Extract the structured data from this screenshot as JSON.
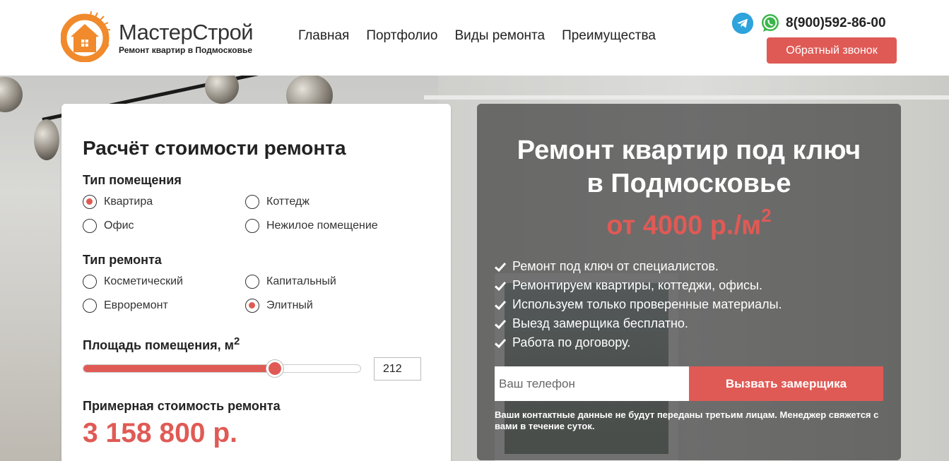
{
  "header": {
    "brand_name": "МастерСтрой",
    "brand_tagline": "Ремонт квартир в Подмосковье",
    "nav": [
      "Главная",
      "Портфолио",
      "Виды ремонта",
      "Преимущества"
    ],
    "phone": "8(900)592-86-00",
    "callback_label": "Обратный звонок",
    "icons": [
      "telegram-icon",
      "whatsapp-icon"
    ]
  },
  "calculator": {
    "title": "Расчёт стоимости ремонта",
    "room_type_label": "Тип помещения",
    "room_types": [
      {
        "label": "Квартира",
        "checked": true
      },
      {
        "label": "Коттедж",
        "checked": false
      },
      {
        "label": "Офис",
        "checked": false
      },
      {
        "label": "Нежилое помещение",
        "checked": false
      }
    ],
    "repair_type_label": "Тип ремонта",
    "repair_types": [
      {
        "label": "Косметический",
        "checked": false
      },
      {
        "label": "Капитальный",
        "checked": false
      },
      {
        "label": "Евроремонт",
        "checked": false
      },
      {
        "label": "Элитный",
        "checked": true
      }
    ],
    "area_label": "Площадь помещения, м",
    "area_unit_sup": "2",
    "area_value": "212",
    "slider_fraction": 0.69,
    "approx_label": "Примерная стоимость ремонта",
    "approx_price": "3 158 800 р."
  },
  "offer": {
    "title_line1": "Ремонт квартир под ключ",
    "title_line2": "в Подмосковье",
    "price_text": "от 4000 р./м",
    "price_sup": "2",
    "benefits": [
      "Ремонт под ключ от специалистов.",
      "Ремонтируем квартиры, коттеджи, офисы.",
      "Используем только проверенные материалы.",
      "Выезд замерщика бесплатно.",
      "Работа по договору."
    ],
    "phone_placeholder": "Ваш телефон",
    "measure_button": "Вызвать замерщика",
    "disclaimer": "Ваши контактные данные не будут переданы третьим лицам. Менеджер свяжется с вами в течение суток."
  },
  "colors": {
    "accent": "#e05a55",
    "logo_orange": "#f08a2c",
    "telegram": "#2ea3dc",
    "whatsapp": "#3cb64a"
  }
}
